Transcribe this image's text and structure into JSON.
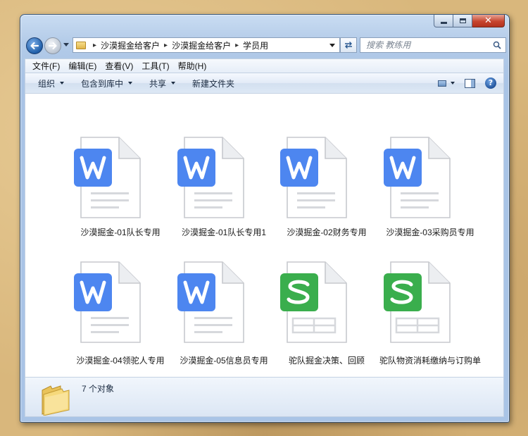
{
  "window": {
    "minimize_icon": "minimize-icon",
    "maximize_icon": "maximize-icon",
    "close_icon": "close-icon"
  },
  "nav": {
    "breadcrumbs": [
      "沙漠掘金给客户",
      "沙漠掘金给客户",
      "学员用"
    ],
    "search_placeholder": "搜索 教练用"
  },
  "menu": [
    "文件(F)",
    "编辑(E)",
    "查看(V)",
    "工具(T)",
    "帮助(H)"
  ],
  "commands": {
    "organize": "组织",
    "include_in_library": "包含到库中",
    "share": "共享",
    "new_folder": "新建文件夹"
  },
  "files": [
    {
      "name": "沙漠掘金-01队长专用",
      "type": "wps-writer",
      "icon": "word-doc-icon"
    },
    {
      "name": "沙漠掘金-01队长专用1",
      "type": "wps-writer",
      "icon": "word-doc-icon"
    },
    {
      "name": "沙漠掘金-02财务专用",
      "type": "wps-writer",
      "icon": "word-doc-icon"
    },
    {
      "name": "沙漠掘金-03采购员专用",
      "type": "wps-writer",
      "icon": "word-doc-icon"
    },
    {
      "name": "沙漠掘金-04领驼人专用",
      "type": "wps-writer",
      "icon": "word-doc-icon"
    },
    {
      "name": "沙漠掘金-05信息员专用",
      "type": "wps-writer",
      "icon": "word-doc-icon"
    },
    {
      "name": "驼队掘金决策、回顾",
      "type": "wps-spreadsheet",
      "icon": "spreadsheet-doc-icon"
    },
    {
      "name": "驼队物资消耗缴纳与订购单",
      "type": "wps-spreadsheet",
      "icon": "spreadsheet-doc-icon"
    }
  ],
  "status": {
    "count": "7 个对象",
    "icon": "folder-icon"
  },
  "colors": {
    "writer_badge": "#4d86f0",
    "sheet_badge": "#3aae4d",
    "desktop": "#d9b77c",
    "window_frame": "#b3cbe8"
  }
}
